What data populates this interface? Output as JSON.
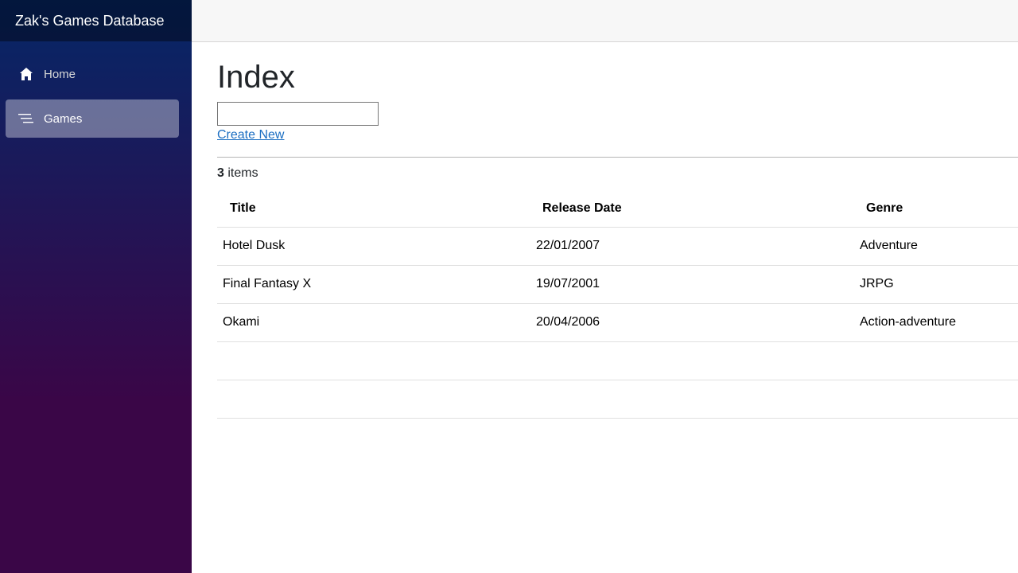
{
  "sidebar": {
    "brand": "Zak's Games Database",
    "items": [
      {
        "label": "Home",
        "icon": "home-icon",
        "active": false
      },
      {
        "label": "Games",
        "icon": "list-icon",
        "active": true
      }
    ]
  },
  "main": {
    "title": "Index",
    "search": {
      "value": "",
      "placeholder": ""
    },
    "create_link": "Create New",
    "count": {
      "number": "3",
      "suffix": " items"
    },
    "table": {
      "headers": [
        "Title",
        "Release Date",
        "Genre"
      ],
      "rows": [
        [
          "Hotel Dusk",
          "22/01/2007",
          "Adventure"
        ],
        [
          "Final Fantasy X",
          "19/07/2001",
          "JRPG"
        ],
        [
          "Okami",
          "20/04/2006",
          "Action-adventure"
        ]
      ]
    }
  },
  "colors": {
    "sidebar_top": "#052767",
    "sidebar_bottom": "#3a0647",
    "link": "#1b6ec2"
  }
}
